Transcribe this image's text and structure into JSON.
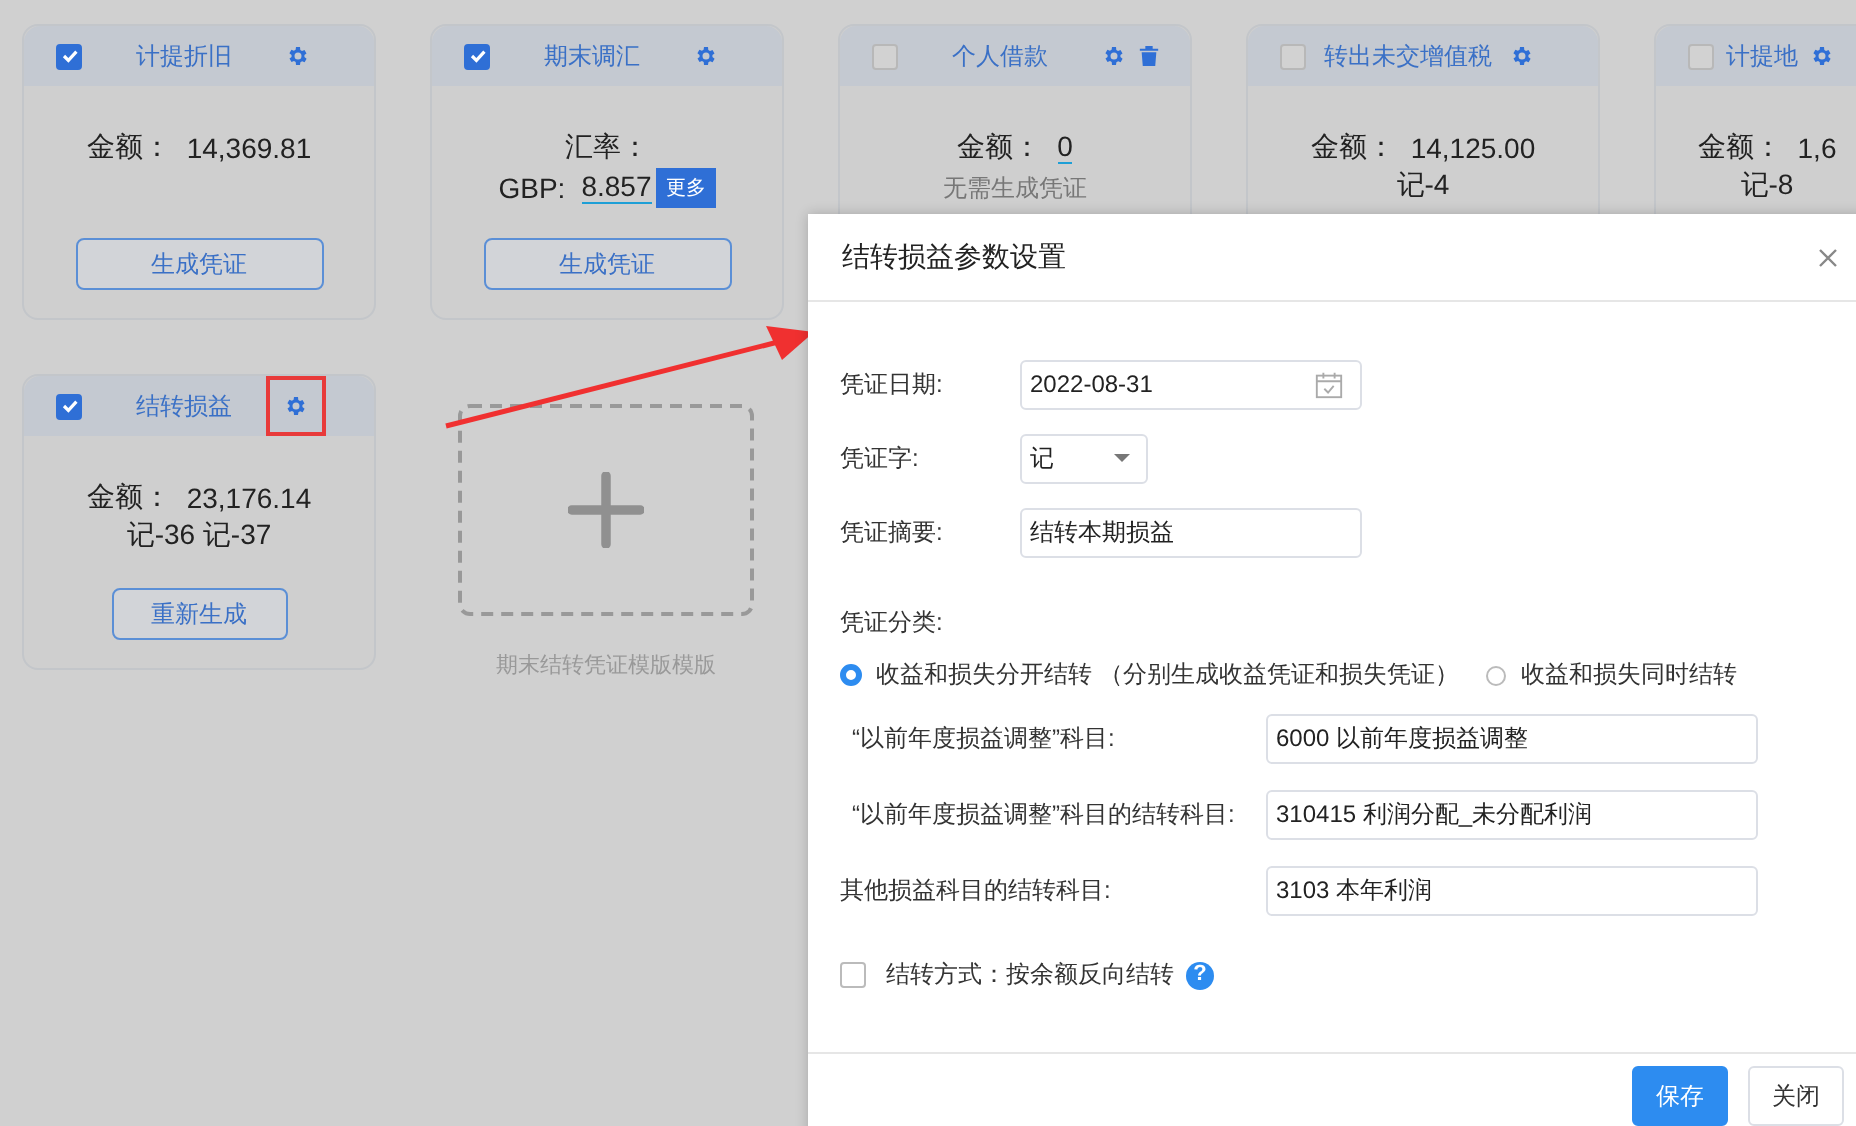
{
  "cards": [
    {
      "title": "计提折旧",
      "checked": true,
      "deletable": false,
      "highlighted": false,
      "lines": [
        {
          "kind": "amount",
          "label": "金额：",
          "value": "14,369.81"
        }
      ],
      "button": "生成凭证"
    },
    {
      "title": "期末调汇",
      "checked": true,
      "deletable": false,
      "highlighted": false,
      "lines": [
        {
          "kind": "text",
          "text": "汇率："
        },
        {
          "kind": "rate",
          "currency": "GBP:",
          "value": "8.857",
          "more": "更多"
        }
      ],
      "button": "生成凭证"
    },
    {
      "title": "个人借款",
      "checked": false,
      "deletable": true,
      "highlighted": false,
      "lines": [
        {
          "kind": "amount_link",
          "label": "金额：",
          "value": "0"
        },
        {
          "kind": "note",
          "text": "无需生成凭证"
        }
      ]
    },
    {
      "title": "转出未交增值税",
      "checked": false,
      "deletable": false,
      "highlighted": false,
      "lines": [
        {
          "kind": "amount",
          "label": "金额：",
          "value": "14,125.00"
        },
        {
          "kind": "text",
          "text": "记-4"
        }
      ]
    },
    {
      "title": "计提地",
      "checked": false,
      "deletable": false,
      "highlighted": false,
      "clipped": true,
      "lines": [
        {
          "kind": "amount",
          "label": "金额：",
          "value": "1,6"
        },
        {
          "kind": "text",
          "text": "记-8"
        }
      ]
    },
    {
      "title": "结转损益",
      "checked": true,
      "deletable": false,
      "highlighted": true,
      "lines": [
        {
          "kind": "amount",
          "label": "金额：",
          "value": "23,176.14"
        },
        {
          "kind": "text",
          "text": "记-36 记-37"
        }
      ],
      "button": "重新生成"
    }
  ],
  "add_tile": {
    "caption": "期末结转凭证模版模版"
  },
  "dialog": {
    "title": "结转损益参数设置",
    "date": {
      "label": "凭证日期:",
      "value": "2022-08-31"
    },
    "word": {
      "label": "凭证字:",
      "value": "记"
    },
    "summary": {
      "label": "凭证摘要:",
      "value": "结转本期损益"
    },
    "category": {
      "label": "凭证分类:",
      "options": [
        {
          "label": "收益和损失分开结转 （分别生成收益凭证和损失凭证）",
          "selected": true
        },
        {
          "label": "收益和损失同时结转",
          "selected": false
        }
      ]
    },
    "accounts": [
      {
        "label": "“以前年度损益调整”科目:",
        "value": "6000 以前年度损益调整",
        "indented": true
      },
      {
        "label": "“以前年度损益调整”科目的结转科目:",
        "value": "310415 利润分配_未分配利润",
        "indented": true
      },
      {
        "label": "其他损益科目的结转科目:",
        "value": "3103 本年利润",
        "indented": false
      }
    ],
    "reverse": {
      "label": "结转方式：按余额反向结转",
      "checked": false,
      "help": "?"
    },
    "buttons": [
      {
        "label": "保存",
        "kind": "primary"
      },
      {
        "label": "关闭",
        "kind": "default"
      }
    ]
  }
}
